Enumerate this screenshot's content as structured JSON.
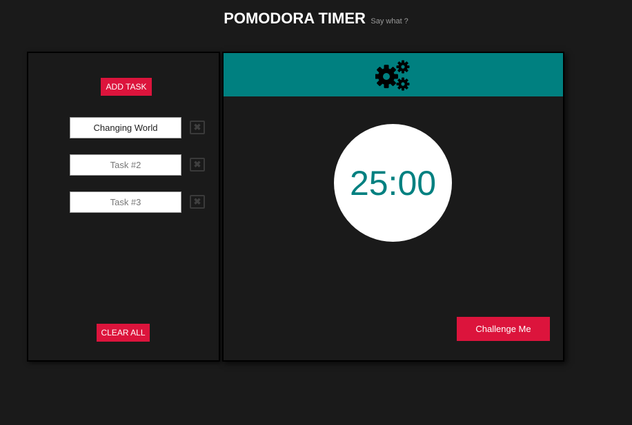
{
  "header": {
    "title": "POMODORA TIMER",
    "subtitle": "Say what ?"
  },
  "tasks": {
    "add_label": "ADD TASK",
    "clear_label": "CLEAR ALL",
    "items": [
      {
        "value": "Changing World",
        "placeholder": ""
      },
      {
        "value": "",
        "placeholder": "Task #2"
      },
      {
        "value": "",
        "placeholder": "Task #3"
      }
    ],
    "delete_glyph": "✖"
  },
  "timer": {
    "settings_icon": "gears-icon",
    "time": "25:00",
    "challenge_label": "Challenge Me"
  },
  "colors": {
    "background": "#1a1a1a",
    "accent": "#008080",
    "button": "#dc143c"
  }
}
